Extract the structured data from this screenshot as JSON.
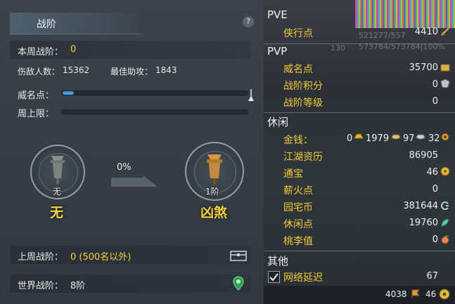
{
  "left": {
    "title": "战阶",
    "help": "?",
    "weekly_tier": {
      "label": "本周战阶：",
      "value": "0"
    },
    "kills": {
      "label": "伤敌人数：",
      "value": "15362"
    },
    "assists": {
      "label": "最佳助攻：",
      "value": "1843"
    },
    "prestige": {
      "label": "威名点：",
      "progress": 0.06
    },
    "weekly_cap": {
      "label": "周上限：",
      "progress": 0
    },
    "current": {
      "badge": "无",
      "name": "无"
    },
    "next": {
      "badge": "1阶",
      "name": "凶煞"
    },
    "percent": "0%",
    "last_week": {
      "label": "上周战阶：",
      "value": "0 (500名以外)"
    },
    "world": {
      "label": "世界战阶：",
      "value": "8阶"
    }
  },
  "right": {
    "pve": {
      "header": "PVE",
      "items": [
        {
          "label": "侠行点",
          "value": "4410",
          "icon": "sword-icon"
        }
      ],
      "overlay": [
        "521277/557",
        "130",
        "573784/573784|100%"
      ]
    },
    "pvp": {
      "header": "PVP",
      "items": [
        {
          "label": "威名点",
          "value": "35700",
          "icon": "prestige-icon"
        },
        {
          "label": "战阶积分",
          "value": "0",
          "icon": "crest-icon"
        },
        {
          "label": "战阶等级",
          "value": "0"
        }
      ]
    },
    "leisure": {
      "header": "休闲",
      "money": {
        "label": "金钱：",
        "v0": "0",
        "v1": "1979",
        "v2": "97",
        "v3": "32"
      },
      "items": [
        {
          "label": "江湖资历",
          "value": "86905"
        },
        {
          "label": "通宝",
          "value": "46",
          "icon": "coin-icon"
        },
        {
          "label": "薪火点",
          "value": "0"
        },
        {
          "label": "园宅币",
          "value": "381644",
          "icon": "house-coin-icon"
        },
        {
          "label": "休闲点",
          "value": "19760",
          "icon": "leaf-icon"
        },
        {
          "label": "桃李值",
          "value": "0",
          "icon": "peach-icon"
        }
      ]
    },
    "other": {
      "header": "其他",
      "latency": {
        "label": "网络延迟",
        "value": "67",
        "checked": true
      }
    },
    "footer": {
      "v1": "4038",
      "v2": "46"
    }
  }
}
